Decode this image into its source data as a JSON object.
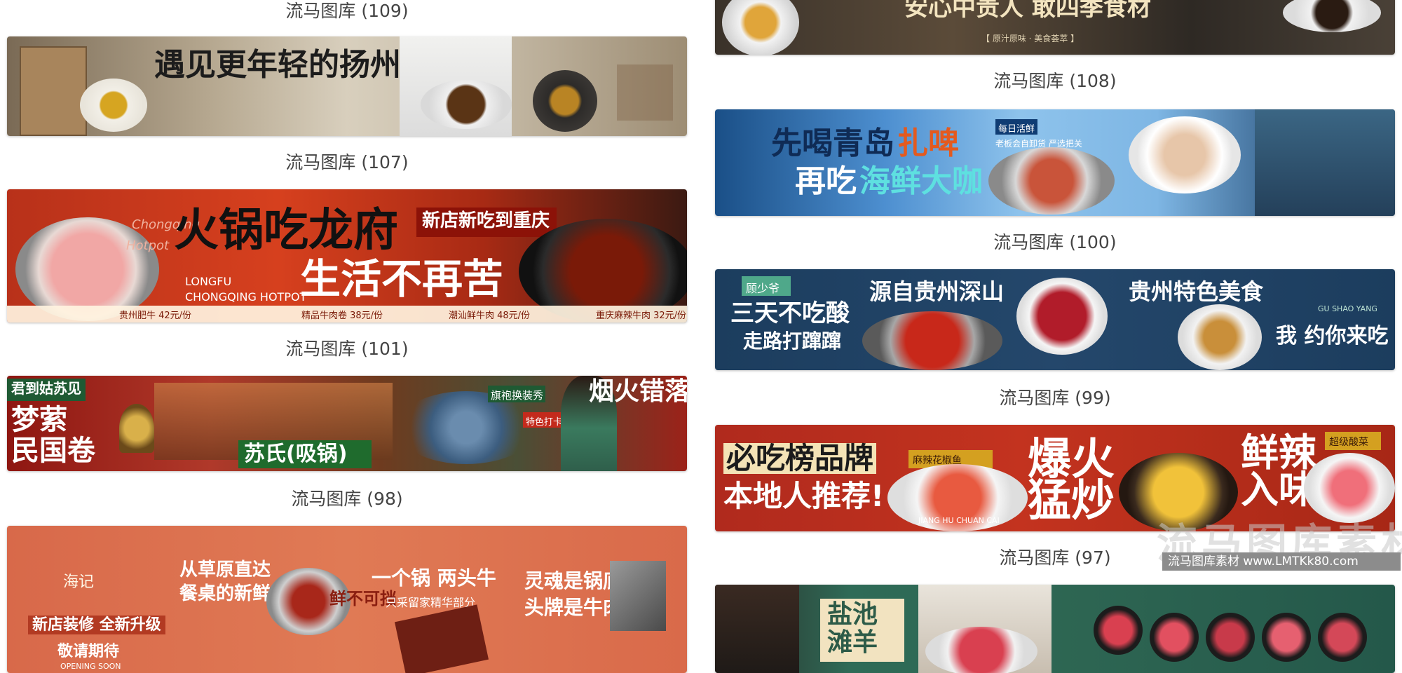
{
  "captions": {
    "c109": "流马图库 (109)",
    "c107": "流马图库 (107)",
    "c101": "流马图库 (101)",
    "c98": "流马图库 (98)",
    "c108": "流马图库 (108)",
    "c100": "流马图库 (100)",
    "c99": "流马图库 (99)",
    "c97": "流马图库 (97)"
  },
  "banners": {
    "b109": {
      "title": "遇见更年轻的扬州"
    },
    "b101": {
      "title": "火锅吃龙府",
      "subtitle": "生活不再苦",
      "tag": "新店新吃到重庆",
      "en_line1": "LONGFU",
      "en_line2": "CHONGQING HOTPOT",
      "side_en1": "Chongqing",
      "side_en2": "Hotpot",
      "prices": [
        "贵州肥牛 42元/份",
        "精品牛肉卷 38元/份",
        "潮汕鲜牛肉 48元/份",
        "重庆麻辣牛肉 32元/份"
      ]
    },
    "b98": {
      "left1": "梦萦",
      "left2": "民国卷",
      "corner": "君到姑苏见",
      "right": "烟火错落",
      "brand": "苏氏(吸锅)",
      "tag1": "旗袍换装秀",
      "tag2": "特色打卡"
    },
    "b96": {
      "brand": "海记",
      "line1": "从草原直达",
      "line2": "餐桌的新鲜",
      "promo1": "新店装修 全新升级",
      "promo2": "敬请期待",
      "en": "OPENING SOON",
      "mid1": "一个锅 两头牛",
      "mid2": "只采留家精华部分",
      "right1": "灵魂是锅底",
      "right2": "头牌是牛肉",
      "stamp": "鲜不可挡"
    },
    "b108": {
      "text": "安心中贵人   敢四季食材",
      "sub": "【 原汁原味 · 美食荟萃 】"
    },
    "b100": {
      "line1a": "先喝青岛",
      "line1b": "扎啤",
      "line2a": "再吃",
      "line2b": "海鲜大咖",
      "tag": "每日活鲜",
      "note": "老板会自卸货 严选把关"
    },
    "b99": {
      "left1": "三天不吃酸",
      "left2": "走路打蹿蹿",
      "mid": "源自贵州深山",
      "right": "贵州特色美食",
      "right2": "我 约你来吃",
      "brand": "顾少爷",
      "en": "GU SHAO YANG"
    },
    "b97": {
      "left1": "必吃榜品牌",
      "left2": "本地人推荐!",
      "en": "JIANG HU CHUAN CAI",
      "mid": "爆火猛炒",
      "right": "鲜辣入味",
      "tag1": "麻辣花椒鱼",
      "tag2": "超级酸菜"
    },
    "b95": {
      "title1": "盐池",
      "title2": "滩羊"
    }
  },
  "watermark": {
    "big": "流马图库素材",
    "bar": "流马图库素材  www.LMTKk80.com"
  }
}
